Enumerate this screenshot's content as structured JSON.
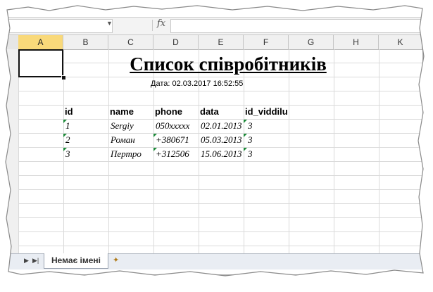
{
  "formula_bar": {
    "fx_label": "fx",
    "name_box": "",
    "value": ""
  },
  "columns": [
    "A",
    "B",
    "C",
    "D",
    "E",
    "F",
    "G",
    "H",
    "K"
  ],
  "active_column": "A",
  "sheet": {
    "title": "Список співробітників",
    "date_text": "Дата: 02.03.2017 16:52:55",
    "headers": [
      "id",
      "name",
      "phone",
      "data",
      "id_viddilu"
    ],
    "rows": [
      {
        "id": "1",
        "name": "Sergiy",
        "phone": "050xxxxx",
        "data": "02.01.2013",
        "id_viddilu": "3"
      },
      {
        "id": "2",
        "name": "Роман",
        "phone": "+380671",
        "data": "05.03.2013",
        "id_viddilu": "3"
      },
      {
        "id": "3",
        "name": "Пертро",
        "phone": "+312506",
        "data": "15.06.2013",
        "id_viddilu": "3"
      }
    ]
  },
  "tabs": {
    "active_label": "Немає імені"
  },
  "colors": {
    "active_header": "#f9d97a",
    "error_triangle": "#1e8a3a",
    "grid": "#dadada"
  }
}
